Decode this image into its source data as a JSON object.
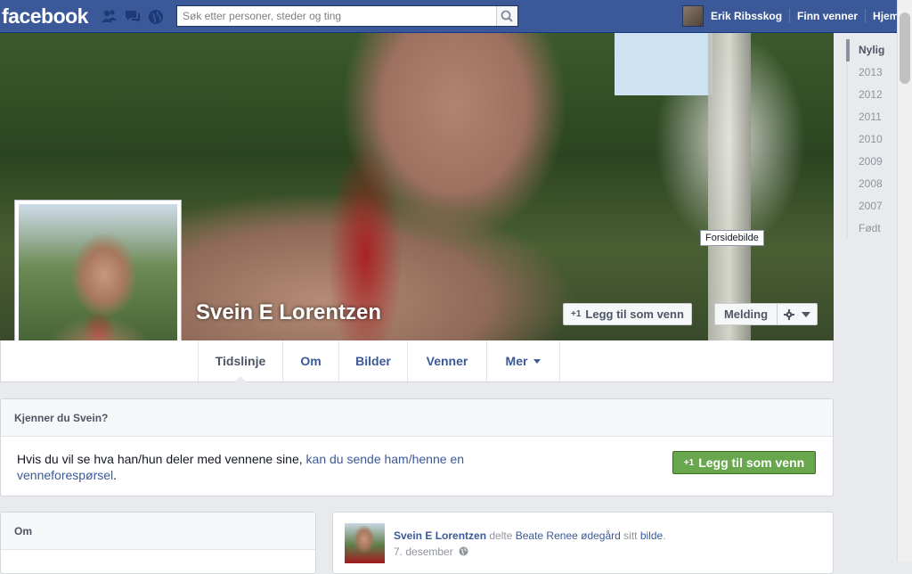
{
  "topbar": {
    "logo": "facebook",
    "search_placeholder": "Søk etter personer, steder og ting",
    "user_name": "Erik Ribsskog",
    "find_friends": "Finn venner",
    "home": "Hjem"
  },
  "profile": {
    "name": "Svein E Lorentzen",
    "cover_label": "Forsidebilde",
    "add_friend_label": "Legg til som venn",
    "message_label": "Melding",
    "plus_one": "+1"
  },
  "tabs": [
    {
      "label": "Tidslinje"
    },
    {
      "label": "Om"
    },
    {
      "label": "Bilder"
    },
    {
      "label": "Venner"
    },
    {
      "label": "Mer"
    }
  ],
  "know_card": {
    "header": "Kjenner du Svein?",
    "text_plain": "Hvis du vil se hva han/hun deler med vennene sine, ",
    "text_link": "kan du sende ham/henne en venneforespørsel",
    "text_end": ".",
    "button_label": "Legg til som venn"
  },
  "om_card": {
    "header": "Om"
  },
  "post": {
    "author": "Svein E Lorentzen",
    "verb": " delte ",
    "target": "Beate Renee ødegård",
    "mid": " sitt ",
    "object": "bilde",
    "end": ".",
    "date": "7. desember"
  },
  "timeline_nav": [
    "Nylig",
    "2013",
    "2012",
    "2011",
    "2010",
    "2009",
    "2008",
    "2007",
    "Født"
  ],
  "colors": {
    "topbar": "#3b5998",
    "link": "#3b5998",
    "green_button": "#69a74e",
    "background": "#e9eaed"
  }
}
